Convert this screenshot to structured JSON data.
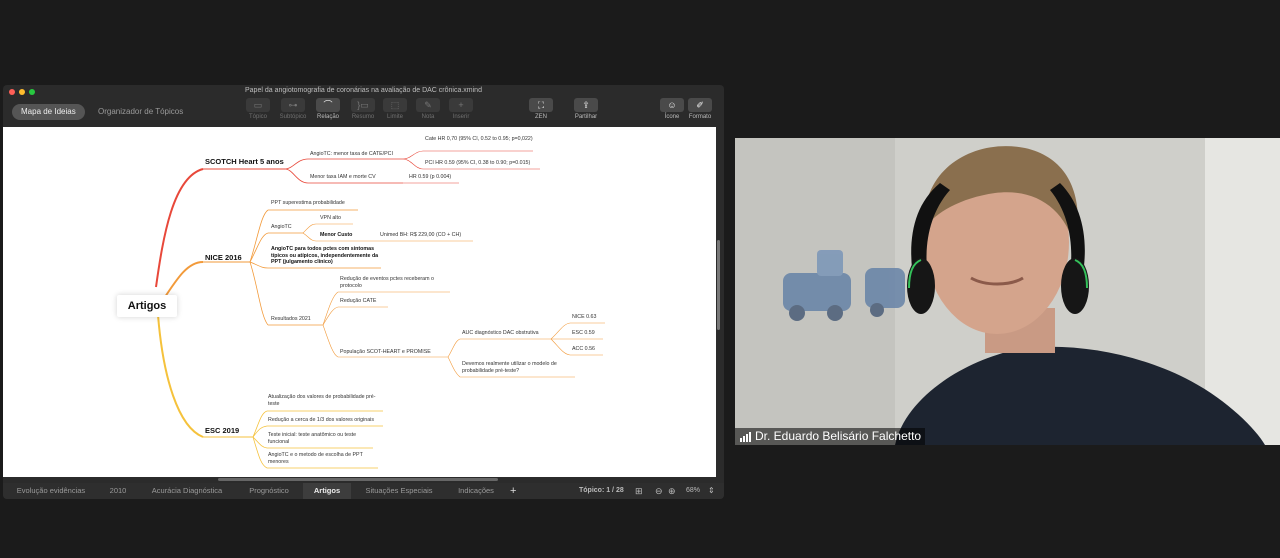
{
  "window": {
    "title": "Papel da angiotomografia de coronárias na avaliação de DAC crônica.xmind"
  },
  "modes": [
    {
      "label": "Mapa de Ideias"
    },
    {
      "label": "Organizador de Tópicos"
    }
  ],
  "tools": {
    "topico": "Tópico",
    "subtopico": "Subtópico",
    "relacao": "Relação",
    "resumo": "Resumo",
    "limite": "Limite",
    "nota": "Nota",
    "inserir": "Inserir",
    "zen": "ZEN",
    "partilhar": "Partilhar",
    "icone": "Ícone",
    "formato": "Formato"
  },
  "map": {
    "root": "Artigos",
    "scotch": {
      "title": "SCOTCH Heart 5 anos",
      "angio": "AngioTC: menor taxa de CATE/PCI",
      "cate": "Cate HR 0,70 (95% CI, 0.52 to 0.95; p=0,022)",
      "pci": "PCI HR 0.59 (95% CI, 0.38 to 0.90; p=0.015)",
      "menor": "Menor taxa IAM e morte CV",
      "hr": "HR 0.59 (p 0.004)"
    },
    "nice": {
      "title": "NICE 2016",
      "ppt": "PPT superestima probabilidade",
      "angio": "AngioTC",
      "vpn": "VPN alto",
      "menor": "Menor Custo",
      "unimed": "Unimed BH: R$ 229,00 (CO + CH)",
      "todos": "AngioTC para todos pctes com sintomas típicos ou atípicos, independentemente da PPT (julgamento clínico)",
      "resultados": "Resultados 2021",
      "reducao_eventos": "Redução de eventos pctes receberam o protocolo",
      "reducao_cate": "Redução CATE",
      "populacao": "População SCOT-HEART e PROMISE",
      "auc": "AUC diagnóstico DAC obstrutiva",
      "nice_auc": "NICE 0.63",
      "esc_auc": "ESC 0.59",
      "acc_auc": "ACC 0.56",
      "devemos": "Devemos realmente utilizar o modelo de probabilidade pré-teste?"
    },
    "esc": {
      "title": "ESC 2019",
      "atual": "Atualização dos valores de probabilidade pré-teste",
      "reducao": "Redução a cerca de 1/3 dos valores originais",
      "teste": "Teste inicial: teste anatômico ou teste funcional",
      "angio": "AngioTC e o metodo de escolha de PPT menores"
    }
  },
  "sheets": [
    {
      "label": "Evolução evidências"
    },
    {
      "label": "2010"
    },
    {
      "label": "Acurácia Diagnóstica"
    },
    {
      "label": "Prognóstico"
    },
    {
      "label": "Artigos"
    },
    {
      "label": "Situações Especiais"
    },
    {
      "label": "Indicações"
    }
  ],
  "status": {
    "add": "+",
    "topic": "Tópico: 1 / 28",
    "minus": "⊖",
    "plus": "⊕",
    "zoom": "68%"
  },
  "participant": {
    "name": "Dr. Eduardo Belisário Falchetto"
  },
  "colors": {
    "branch_red": "#e8483a",
    "branch_orange": "#f29a3a",
    "branch_yellow": "#f5c23c",
    "window_bg": "#2b2b2b"
  }
}
